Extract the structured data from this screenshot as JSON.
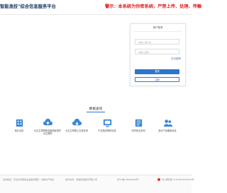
{
  "header": {
    "title": "智能渔技\"综合信息服务平台",
    "warning": "警示：本系统为你密系统，严禁上传、处理、传輸"
  },
  "login": {
    "title": "用户登录",
    "username_placeholder": "请输入用户名",
    "password_placeholder": "请输入密码",
    "forgot": "忘记密码",
    "login_button": "登录",
    "register_button": "注册"
  },
  "query": {
    "title": "数据查询",
    "items": [
      {
        "label": "渔业动态",
        "icon": "building-icon"
      },
      {
        "label": "水生生物物种危害国家保护水生物种",
        "icon": "cloud-up-icon"
      },
      {
        "label": "水生生物禁止名录查询",
        "icon": "cloud-down-icon"
      },
      {
        "label": "不法渔具物种目录",
        "icon": "screen-icon"
      },
      {
        "label": "科学渔业咨询",
        "icon": "book-icon"
      },
      {
        "label": "渔光产品备案信息",
        "icon": "people-icon"
      }
    ]
  },
  "footer": {
    "links": "友情链接：农业农村部渔业渔政管理局 · 中国水产学会",
    "support": "技术支持：海诺科技股份有限公司",
    "icp": "京ICP备 09008458号",
    "police": "京公网安备 11010502000005号"
  },
  "colors": {
    "brand": "#1d3c63",
    "accent": "#2d76c9",
    "warning": "#e02020"
  }
}
